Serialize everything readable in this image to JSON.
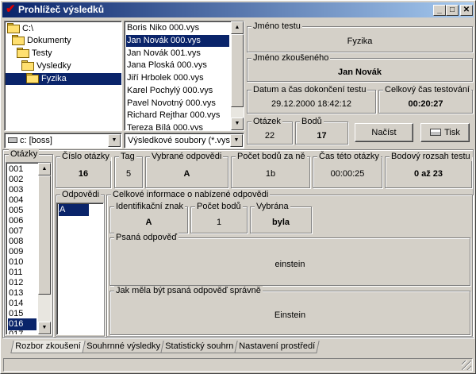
{
  "window": {
    "title": "Prohlížeč výsledků",
    "min": "_",
    "max": "□",
    "close": "✕"
  },
  "tree": [
    "C:\\",
    "Dokumenty",
    "Testy",
    "Vysledky",
    "Fyzika"
  ],
  "files": [
    "Boris Niko 000.vys",
    "Jan Novák 000.vys",
    "Jan Novák 001.vys",
    "Jana Ploská 000.vys",
    "Jiří Hrbolek 000.vys",
    "Karel Pochylý 000.vys",
    "Pavel Novotný 000.vys",
    "Richard Rejthar 000.vys",
    "Tereza Bílá 000.vys"
  ],
  "drive": "c: [boss]",
  "filter": "Výsledkové soubory (*.vys)",
  "test": {
    "name_label": "Jméno testu",
    "name": "Fyzika",
    "examinee_label": "Jméno zkoušeného",
    "examinee": "Jan Novák",
    "date_label": "Datum a čas dokončení testu",
    "date": "29.12.2000  18:42:12",
    "total_time_label": "Celkový čas testování",
    "total_time": "00:20:27",
    "questions_label": "Otázek",
    "questions": "22",
    "points_label": "Bodů",
    "points": "17",
    "load_button": "Načíst",
    "print_button": "Tisk"
  },
  "question": {
    "list_label": "Otázky",
    "list": [
      "001",
      "002",
      "003",
      "004",
      "005",
      "006",
      "007",
      "008",
      "009",
      "010",
      "011",
      "012",
      "013",
      "014",
      "015",
      "016",
      "017"
    ],
    "number_label": "Číslo otázky",
    "number": "16",
    "tag_label": "Tag",
    "tag": "5",
    "selected_label": "Vybrané odpovědi",
    "selected": "A",
    "points_label": "Počet bodů za ně",
    "points": "1b",
    "time_label": "Čas této otázky",
    "time": "00:00:25",
    "range_label": "Bodový rozsah testu",
    "range": "0 až 23"
  },
  "answers": {
    "label": "Odpovědi",
    "list": [
      "A"
    ]
  },
  "answer_info": {
    "label": "Celkové informace o nabízené odpovědi",
    "id_label": "Identifikační znak",
    "id": "A",
    "points_label": "Počet bodů",
    "points": "1",
    "chosen_label": "Vybrána",
    "chosen": "byla",
    "written_label": "Psaná odpověď",
    "written": "einstein",
    "correct_label": "Jak měla být psaná odpověď správně",
    "correct": "Einstein"
  },
  "tabs": [
    "Rozbor zkoušení",
    "Souhrnné výsledky",
    "Statistický souhrn",
    "Nastavení prostředí"
  ]
}
